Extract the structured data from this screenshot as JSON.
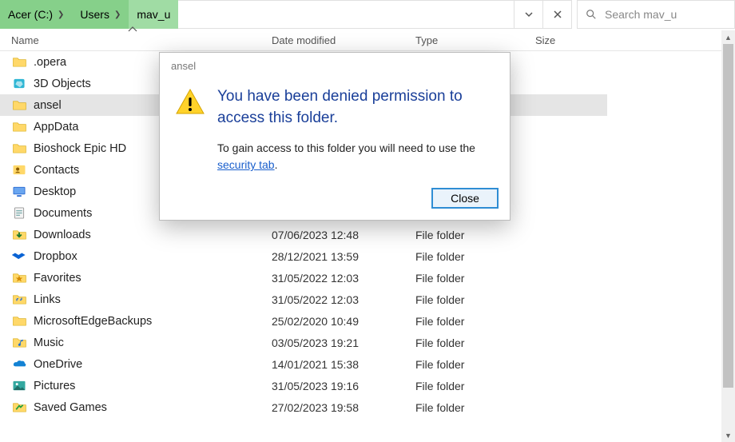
{
  "breadcrumb": {
    "a": "Acer (C:)",
    "b": "Users",
    "c": "mav_u"
  },
  "search": {
    "placeholder": "Search mav_u"
  },
  "cols": {
    "name": "Name",
    "date": "Date modified",
    "type": "Type",
    "size": "Size"
  },
  "folders": [
    {
      "name": ".opera",
      "date": "",
      "type": "",
      "icon": "folder"
    },
    {
      "name": "3D Objects",
      "date": "",
      "type": "",
      "icon": "3d"
    },
    {
      "name": "ansel",
      "date": "",
      "type": "",
      "icon": "folder",
      "selected": true,
      "wide": true
    },
    {
      "name": "AppData",
      "date": "",
      "type": "",
      "icon": "folder"
    },
    {
      "name": "Bioshock Epic HD",
      "date": "",
      "type": "",
      "icon": "folder"
    },
    {
      "name": "Contacts",
      "date": "",
      "type": "",
      "icon": "contacts"
    },
    {
      "name": "Desktop",
      "date": "",
      "type": "",
      "icon": "desktop"
    },
    {
      "name": "Documents",
      "date": "",
      "type": "",
      "icon": "doc"
    },
    {
      "name": "Downloads",
      "date": "07/06/2023 12:48",
      "type": "File folder",
      "icon": "down"
    },
    {
      "name": "Dropbox",
      "date": "28/12/2021 13:59",
      "type": "File folder",
      "icon": "dropbox"
    },
    {
      "name": "Favorites",
      "date": "31/05/2022 12:03",
      "type": "File folder",
      "icon": "fav"
    },
    {
      "name": "Links",
      "date": "31/05/2022 12:03",
      "type": "File folder",
      "icon": "links"
    },
    {
      "name": "MicrosoftEdgeBackups",
      "date": "25/02/2020 10:49",
      "type": "File folder",
      "icon": "folder"
    },
    {
      "name": "Music",
      "date": "03/05/2023 19:21",
      "type": "File folder",
      "icon": "music"
    },
    {
      "name": "OneDrive",
      "date": "14/01/2021 15:38",
      "type": "File folder",
      "icon": "onedrive"
    },
    {
      "name": "Pictures",
      "date": "31/05/2023 19:16",
      "type": "File folder",
      "icon": "pic"
    },
    {
      "name": "Saved Games",
      "date": "27/02/2023 19:58",
      "type": "File folder",
      "icon": "saved"
    }
  ],
  "dialog": {
    "title": "ansel",
    "heading": "You have been denied permission to access this folder.",
    "text_before": "To gain access to this folder you will need to use the ",
    "link": "security tab",
    "text_after": ".",
    "close": "Close"
  }
}
